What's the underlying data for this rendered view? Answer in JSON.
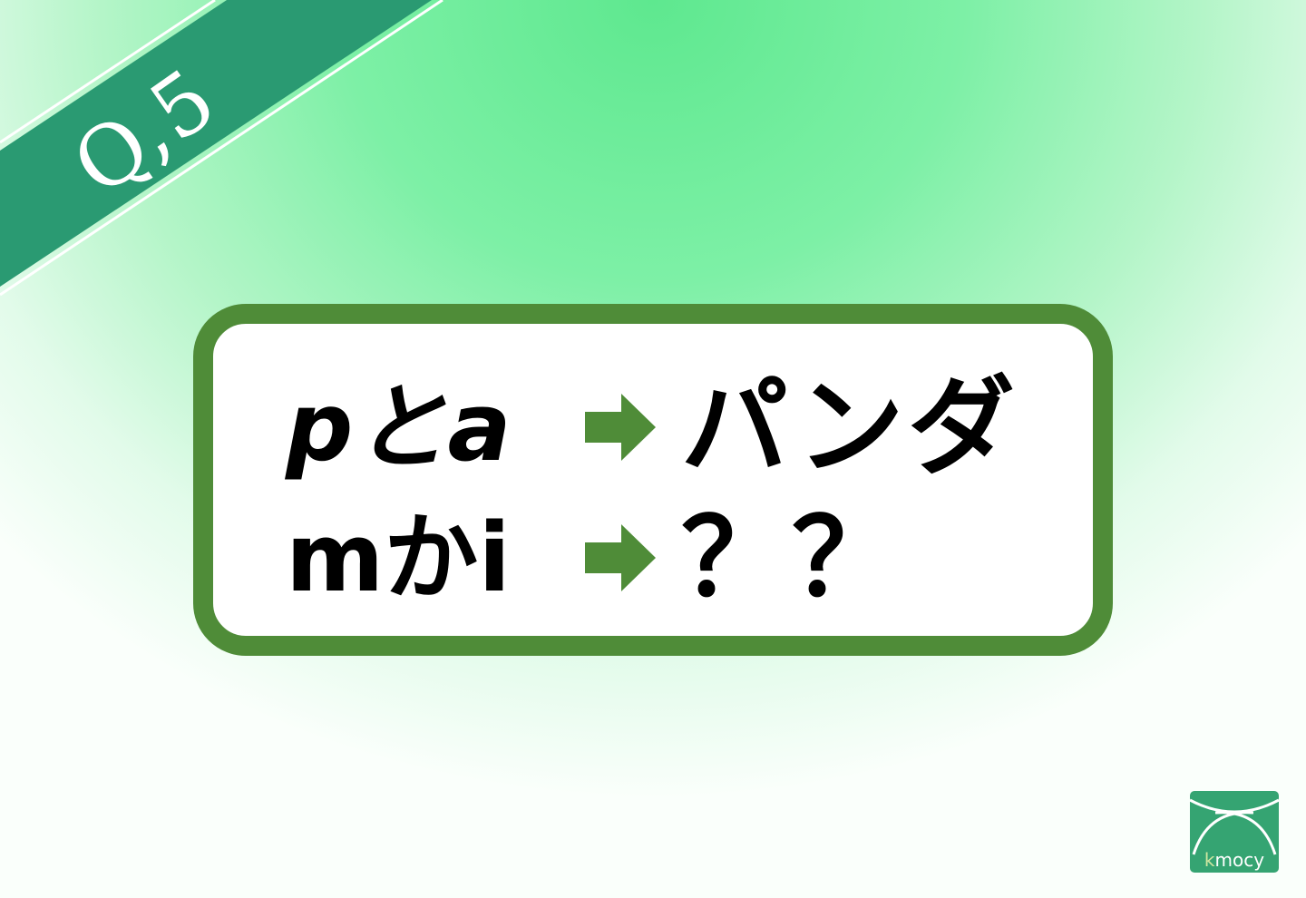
{
  "question_label": "Q,5",
  "puzzle": {
    "row1": {
      "left": "pとa",
      "right": "パンダ"
    },
    "row2": {
      "left": "mかi",
      "right": "？？"
    }
  },
  "logo": {
    "first_letter": "k",
    "rest": "mocy"
  },
  "colors": {
    "ribbon": "#2a9a72",
    "card_border": "#4f8c38",
    "arrow": "#4f8c38",
    "logo_bg": "#35a472",
    "background_center": "#5ee88f"
  },
  "icons": [
    "right-arrow-icon",
    "kmocy-logo"
  ]
}
